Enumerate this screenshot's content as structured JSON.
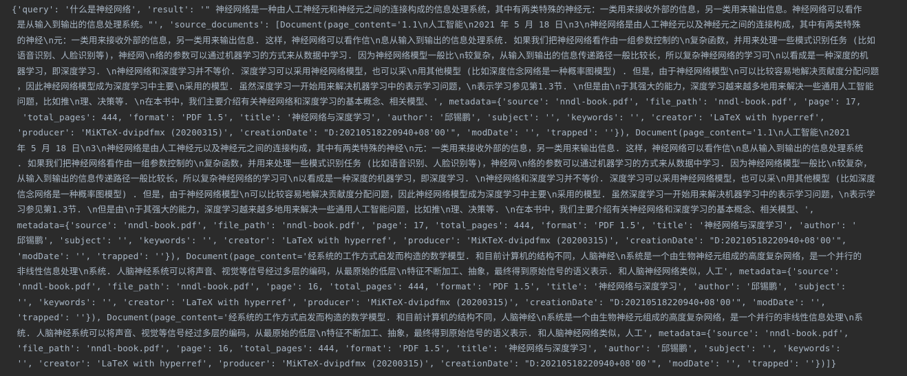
{
  "colors": {
    "background": "#2b2b2b",
    "text": "#a9b7c6"
  },
  "console": {
    "lines": [
      "{'query': '什么是神经网络', 'result': '\" 神经网络是一种由人工神经元和神经元之间的连接构成的信息处理系统，其中有两类特殊的神经元：一类用来接收外部的信息，另一类用来输出信息。神经网络可以看作",
      " 是从输入到输出的信息处理系统。\"', 'source_documents': [Document(page_content='1.1\\n人工智能\\n2021 年 5 月 18 日\\n3\\n神经网络是由人工神经元以及神经元之间的连接构成，其中有两类特殊",
      " 的神经\\n元：一类用来接收外部的信息，另一类用来输出信息. 这样，神经网络可以看作信\\n息从输入到输出的信息处理系统. 如果我们把神经网络看作由一组参数控制的\\n复杂函数，并用来处理一些模式识别任务 (比如",
      " 语音识别、人脸识别等)，神经网\\n络的参数可以通过机器学习的方式来从数据中学习. 因为神经网络模型一般比\\n较复杂，从输入到输出的信息传递路径一般比较长，所以复杂神经网络的学习可\\n以看成是一种深度的机",
      " 器学习，即深度学习. \\n神经网络和深度学习并不等价. 深度学习可以采用神经网络模型，也可以采\\n用其他模型 (比如深度信念网络是一种概率图模型) . 但是，由于神经网络模型\\n可以比较容易地解决贡献度分配问题",
      " ，因此神经网络模型成为深度学习中主要\\n采用的模型. 虽然深度学习一开始用来解决机器学习中的表示学习问题，\\n表示学习参见第1.3节. \\n但是由\\n于其强大的能力，深度学习越来越多地用来解决一些通用人工智能",
      " 问题，比如推\\n理、决策等. \\n在本书中，我们主要介绍有关神经网络和深度学习的基本概念、相关模型、', metadata={'source': 'nndl-book.pdf', 'file_path': 'nndl-book.pdf', 'page': 17,",
      "  'total_pages': 444, 'format': 'PDF 1.5', 'title': '神经网络与深度学习', 'author': '邱锡鹏', 'subject': '', 'keywords': '', 'creator': 'LaTeX with hyperref',",
      " 'producer': 'MiKTeX-dvipdfmx (20200315)', 'creationDate': \"D:20210518220940+08'00'\", 'modDate': '', 'trapped': ''}), Document(page_content='1.1\\n人工智能\\n2021",
      " 年 5 月 18 日\\n3\\n神经网络是由人工神经元以及神经元之间的连接构成，其中有两类特殊的神经\\n元：一类用来接收外部的信息，另一类用来输出信息. 这样，神经网络可以看作信\\n息从输入到输出的信息处理系统",
      " . 如果我们把神经网络看作由一组参数控制的\\n复杂函数，并用来处理一些模式识别任务 (比如语音识别、人脸识别等)，神经网\\n络的参数可以通过机器学习的方式来从数据中学习. 因为神经网络模型一般比\\n较复杂，",
      " 从输入到输出的信息传递路径一般比较长，所以复杂神经网络的学习可\\n以看成是一种深度的机器学习，即深度学习. \\n神经网络和深度学习并不等价. 深度学习可以采用神经网络模型，也可以采\\n用其他模型 (比如深度",
      " 信念网络是一种概率图模型) . 但是，由于神经网络模型\\n可以比较容易地解决贡献度分配问题，因此神经网络模型成为深度学习中主要\\n采用的模型. 虽然深度学习一开始用来解决机器学习中的表示学习问题，\\n表示学",
      " 习参见第1.3节. \\n但是由\\n于其强大的能力，深度学习越来越多地用来解决一些通用人工智能问题，比如推\\n理、决策等. \\n在本书中，我们主要介绍有关神经网络和深度学习的基本概念、相关模型、',",
      " metadata={'source': 'nndl-book.pdf', 'file_path': 'nndl-book.pdf', 'page': 17, 'total_pages': 444, 'format': 'PDF 1.5', 'title': '神经网络与深度学习', 'author': '",
      " 邱锡鹏', 'subject': '', 'keywords': '', 'creator': 'LaTeX with hyperref', 'producer': 'MiKTeX-dvipdfmx (20200315)', 'creationDate': \"D:20210518220940+08'00'\",",
      " 'modDate': '', 'trapped': ''}), Document(page_content='经系统的工作方式启发而构造的数学模型. 和目前计算机的结构不同，人脑神经\\n系统是一个由生物神经元组成的高度复杂网络，是一个并行的",
      " 非线性信息处理\\n系统. 人脑神经系统可以将声音、视觉等信号经过多层的编码，从最原始的低层\\n特征不断加工、抽象，最终得到原始信号的语义表示. 和人脑神经网络类似，人工', metadata={'source':",
      " 'nndl-book.pdf', 'file_path': 'nndl-book.pdf', 'page': 16, 'total_pages': 444, 'format': 'PDF 1.5', 'title': '神经网络与深度学习', 'author': '邱锡鹏', 'subject':",
      " '', 'keywords': '', 'creator': 'LaTeX with hyperref', 'producer': 'MiKTeX-dvipdfmx (20200315)', 'creationDate': \"D:20210518220940+08'00'\", 'modDate': '',",
      " 'trapped': ''}), Document(page_content='经系统的工作方式启发而构造的数学模型. 和目前计算机的结构不同，人脑神经\\n系统是一个由生物神经元组成的高度复杂网络，是一个并行的非线性信息处理\\n系",
      " 统. 人脑神经系统可以将声音、视觉等信号经过多层的编码，从最原始的低层\\n特征不断加工、抽象，最终得到原始信号的语义表示. 和人脑神经网络类似，人工', metadata={'source': 'nndl-book.pdf',",
      " 'file_path': 'nndl-book.pdf', 'page': 16, 'total_pages': 444, 'format': 'PDF 1.5', 'title': '神经网络与深度学习', 'author': '邱锡鹏', 'subject': '', 'keywords':",
      " '', 'creator': 'LaTeX with hyperref', 'producer': 'MiKTeX-dvipdfmx (20200315)', 'creationDate': \"D:20210518220940+08'00'\", 'modDate': '', 'trapped': ''})]}"
    ]
  }
}
